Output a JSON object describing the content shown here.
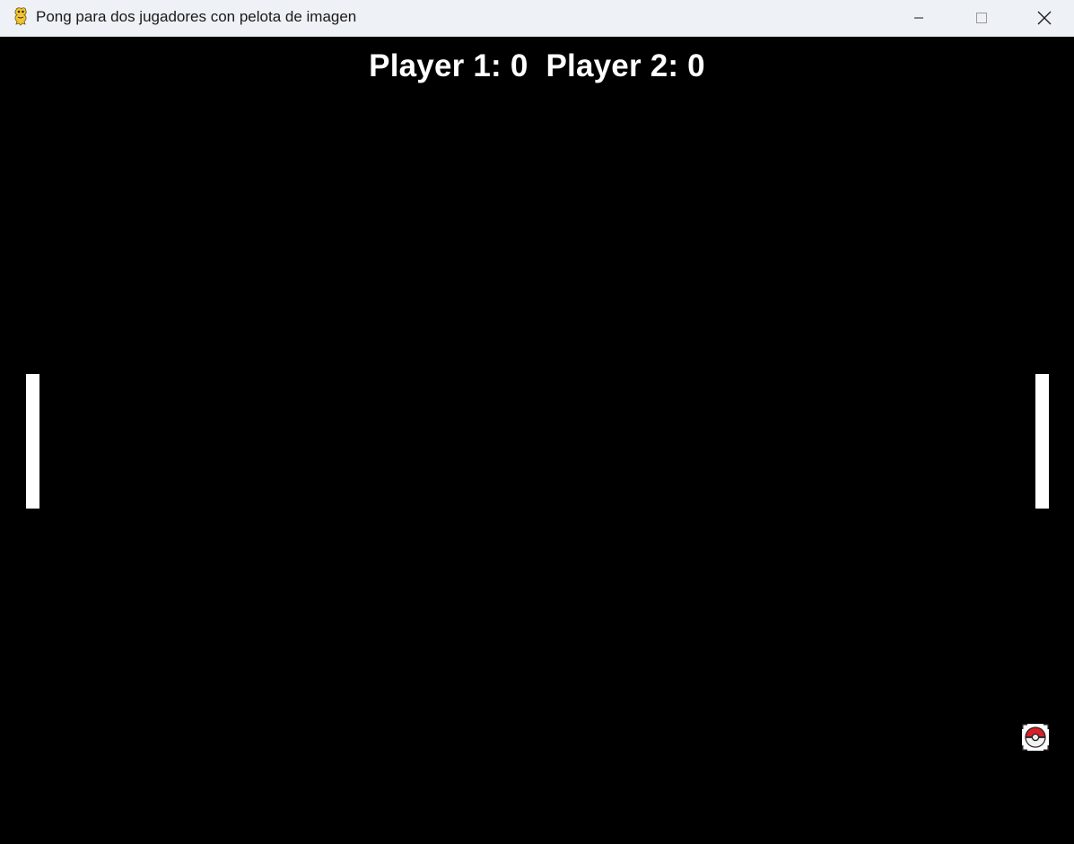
{
  "window": {
    "title": "Pong para dos jugadores con pelota de imagen",
    "app_icon": "pygame-snake-icon",
    "controls": {
      "minimize_icon": "minimize-icon",
      "maximize_icon": "maximize-icon",
      "close_icon": "close-icon"
    }
  },
  "game": {
    "background_color": "#000000",
    "foreground_color": "#ffffff",
    "player1_label": "Player 1: 0",
    "player2_label": "Player 2: 0",
    "ball_icon": "pokeball-icon"
  }
}
